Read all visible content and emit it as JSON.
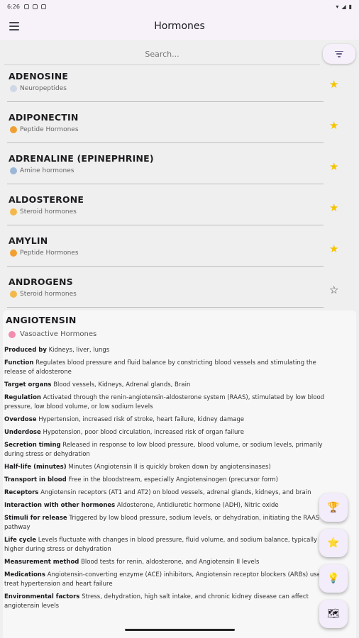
{
  "status_bar": {
    "time": "6:26"
  },
  "app_bar": {
    "title": "Hormones"
  },
  "search": {
    "placeholder": "Search..."
  },
  "list": [
    {
      "name": "ADENOSINE",
      "category": "Neuropeptides",
      "icon": "speech-bubble-icon",
      "favorite": true
    },
    {
      "name": "ADIPONECTIN",
      "category": "Peptide Hormones",
      "icon": "face-icon",
      "favorite": true
    },
    {
      "name": "ADRENALINE (EPINEPHRINE)",
      "category": "Amine hormones",
      "icon": "flask-icon",
      "favorite": true
    },
    {
      "name": "ALDOSTERONE",
      "category": "Steroid hormones",
      "icon": "muscle-icon",
      "favorite": true
    },
    {
      "name": "AMYLIN",
      "category": "Peptide Hormones",
      "icon": "face-icon",
      "favorite": true
    },
    {
      "name": "ANDROGENS",
      "category": "Steroid hormones",
      "icon": "muscle-icon",
      "favorite": false
    }
  ],
  "detail": {
    "name": "ANGIOTENSIN",
    "category": "Vasoactive Hormones",
    "fields": [
      {
        "label": "Produced by",
        "value": "Kidneys, liver, lungs"
      },
      {
        "label": "Function",
        "value": "Regulates blood pressure and fluid balance by constricting blood vessels and stimulating the release of aldosterone"
      },
      {
        "label": "Target organs",
        "value": "Blood vessels, Kidneys, Adrenal glands, Brain"
      },
      {
        "label": "Regulation",
        "value": "Activated through the renin-angiotensin-aldosterone system (RAAS), stimulated by low blood pressure, low blood volume, or low sodium levels"
      },
      {
        "label": "Overdose",
        "value": "Hypertension, increased risk of stroke, heart failure, kidney damage"
      },
      {
        "label": "Underdose",
        "value": "Hypotension, poor blood circulation, increased risk of organ failure"
      },
      {
        "label": "Secretion timing",
        "value": "Released in response to low blood pressure, blood volume, or sodium levels, primarily during stress or dehydration"
      },
      {
        "label": "Half-life (minutes)",
        "value": "Minutes (Angiotensin II is quickly broken down by angiotensinases)"
      },
      {
        "label": "Transport in blood",
        "value": "Free in the bloodstream, especially Angiotensinogen (precursor form)"
      },
      {
        "label": "Receptors",
        "value": "Angiotensin receptors (AT1 and AT2) on blood vessels, adrenal glands, kidneys, and brain"
      },
      {
        "label": "Interaction with other hormones",
        "value": "Aldosterone, Antidiuretic hormone (ADH), Nitric oxide"
      },
      {
        "label": "Stimuli for release",
        "value": "Triggered by low blood pressure, sodium levels, or dehydration, initiating the RAAS pathway"
      },
      {
        "label": "Life cycle",
        "value": "Levels fluctuate with changes in blood pressure, fluid volume, and sodium balance, typically higher during stress or dehydration"
      },
      {
        "label": "Measurement method",
        "value": "Blood tests for renin, aldosterone, and Angiotensin II levels"
      },
      {
        "label": "Medications",
        "value": "Angiotensin-converting enzyme (ACE) inhibitors, Angiotensin receptor blockers (ARBs) used to treat hypertension and heart failure"
      },
      {
        "label": "Environmental factors",
        "value": "Stress, dehydration, high salt intake, and chronic kidney disease can affect angiotensin levels"
      }
    ]
  },
  "fabs": [
    {
      "name": "trophy-fab",
      "glyph": "🏆"
    },
    {
      "name": "star-fab",
      "glyph": "⭐"
    },
    {
      "name": "lightbulb-fab",
      "glyph": "💡"
    },
    {
      "name": "map-fab",
      "glyph": "🗺"
    }
  ],
  "colors": {
    "accent": "#6a5a8a",
    "star": "#f5c400",
    "background": "#efefef"
  }
}
